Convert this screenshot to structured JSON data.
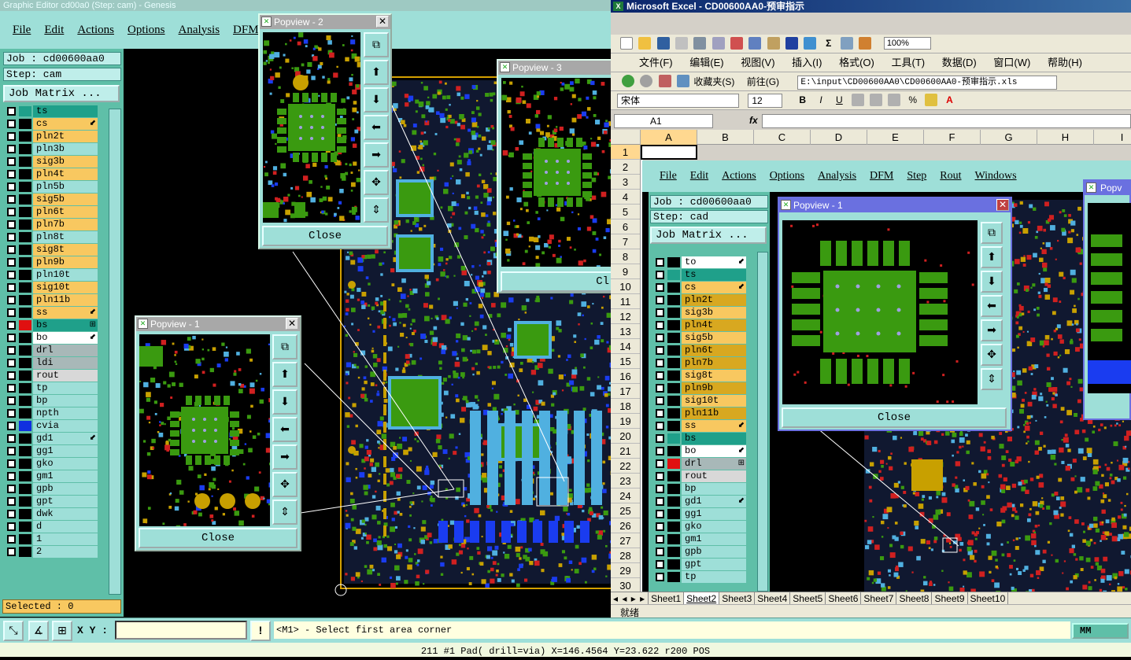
{
  "genesis": {
    "title": "Graphic Editor cd00a0 (Step: cam) - Genesis",
    "menu": [
      "File",
      "Edit",
      "Actions",
      "Options",
      "Analysis",
      "DFM"
    ],
    "job": "Job : cd00600aa0",
    "step": "Step: cam",
    "job_matrix": "Job Matrix ...",
    "layers": [
      {
        "name": "ts",
        "bg": "#1fa08a",
        "color": "#1fa08a",
        "mark": ""
      },
      {
        "name": "cs",
        "bg": "#f8c860",
        "color": "#000",
        "mark": "⬋"
      },
      {
        "name": "pln2t",
        "bg": "#f8c860",
        "color": "#000",
        "mark": ""
      },
      {
        "name": "pln3b",
        "bg": "#9edfd8",
        "color": "#000",
        "mark": ""
      },
      {
        "name": "sig3b",
        "bg": "#f8c860",
        "color": "#000",
        "mark": ""
      },
      {
        "name": "pln4t",
        "bg": "#f8c860",
        "color": "#000",
        "mark": ""
      },
      {
        "name": "pln5b",
        "bg": "#9edfd8",
        "color": "#000",
        "mark": ""
      },
      {
        "name": "sig5b",
        "bg": "#f8c860",
        "color": "#000",
        "mark": ""
      },
      {
        "name": "pln6t",
        "bg": "#f8c860",
        "color": "#000",
        "mark": ""
      },
      {
        "name": "pln7b",
        "bg": "#f8c860",
        "color": "#000",
        "mark": ""
      },
      {
        "name": "pln8t",
        "bg": "#9edfd8",
        "color": "#000",
        "mark": ""
      },
      {
        "name": "sig8t",
        "bg": "#f8c860",
        "color": "#000",
        "mark": ""
      },
      {
        "name": "pln9b",
        "bg": "#f8c860",
        "color": "#000",
        "mark": ""
      },
      {
        "name": "pln10t",
        "bg": "#9edfd8",
        "color": "#000",
        "mark": ""
      },
      {
        "name": "sig10t",
        "bg": "#f8c860",
        "color": "#000",
        "mark": ""
      },
      {
        "name": "pln11b",
        "bg": "#f8c860",
        "color": "#000",
        "mark": ""
      },
      {
        "name": "ss",
        "bg": "#f8c860",
        "color": "#000",
        "mark": "⬋"
      },
      {
        "name": "bs",
        "bg": "#1fa08a",
        "color": "#e01010",
        "mark": "⊞"
      },
      {
        "name": "bo",
        "bg": "#ffffff",
        "color": "#000",
        "mark": "⬋"
      },
      {
        "name": "drl",
        "bg": "#a8b8b8",
        "color": "#000",
        "mark": ""
      },
      {
        "name": "ldi",
        "bg": "#a8b8b8",
        "color": "#000",
        "mark": ""
      },
      {
        "name": "rout",
        "bg": "#d8d8d8",
        "color": "#000",
        "mark": ""
      },
      {
        "name": "tp",
        "bg": "#9edfd8",
        "color": "#000",
        "mark": ""
      },
      {
        "name": "bp",
        "bg": "#9edfd8",
        "color": "#000",
        "mark": ""
      },
      {
        "name": "npth",
        "bg": "#9edfd8",
        "color": "#000",
        "mark": ""
      },
      {
        "name": "cvia",
        "bg": "#9edfd8",
        "color": "#1030e0",
        "mark": ""
      },
      {
        "name": "gd1",
        "bg": "#9edfd8",
        "color": "#000",
        "mark": "⬋"
      },
      {
        "name": "gg1",
        "bg": "#9edfd8",
        "color": "#000",
        "mark": ""
      },
      {
        "name": "gko",
        "bg": "#9edfd8",
        "color": "#000",
        "mark": ""
      },
      {
        "name": "gm1",
        "bg": "#9edfd8",
        "color": "#000",
        "mark": ""
      },
      {
        "name": "gpb",
        "bg": "#9edfd8",
        "color": "#000",
        "mark": ""
      },
      {
        "name": "gpt",
        "bg": "#9edfd8",
        "color": "#000",
        "mark": ""
      },
      {
        "name": "dwk",
        "bg": "#9edfd8",
        "color": "#000",
        "mark": ""
      },
      {
        "name": "d",
        "bg": "#9edfd8",
        "color": "#000",
        "mark": ""
      },
      {
        "name": "1",
        "bg": "#9edfd8",
        "color": "#000",
        "mark": ""
      },
      {
        "name": "2",
        "bg": "#9edfd8",
        "color": "#000",
        "mark": ""
      }
    ],
    "selected": "Selected : 0",
    "xy_label": "X Y :",
    "prompt": "<M1> - Select first area corner",
    "units": "MM",
    "status": "211 #1 Pad( drill=via) X=146.4564 Y=23.622 r200 POS"
  },
  "popviews": {
    "p1_title": "Popview - 1",
    "p2_title": "Popview - 2",
    "p3_title": "Popview - 3",
    "close": "Close",
    "close_short": "Cl"
  },
  "excel": {
    "title": "Microsoft Excel - CD00600AA0-预审指示",
    "menu": [
      "文件(F)",
      "编辑(E)",
      "视图(V)",
      "插入(I)",
      "格式(O)",
      "工具(T)",
      "数据(D)",
      "窗口(W)",
      "帮助(H)"
    ],
    "zoom": "100%",
    "favorites": "收藏夹(S)",
    "goto": "前往(G)",
    "path": "E:\\input\\CD00600AA0\\CD00600AA0-预审指示.xls",
    "font": "宋体",
    "font_size": "12",
    "name_box": "A1",
    "fx": "fx",
    "columns": [
      "A",
      "B",
      "C",
      "D",
      "E",
      "F",
      "G",
      "H",
      "I"
    ],
    "rows": [
      "1",
      "2",
      "3",
      "4",
      "5",
      "6",
      "7",
      "8",
      "9",
      "10",
      "11",
      "12",
      "13",
      "14",
      "15",
      "16",
      "17",
      "18",
      "19",
      "20",
      "21",
      "22",
      "23",
      "24",
      "25",
      "26",
      "27",
      "28",
      "29",
      "30"
    ],
    "sheets": [
      "Sheet1",
      "Sheet2",
      "Sheet3",
      "Sheet4",
      "Sheet5",
      "Sheet6",
      "Sheet7",
      "Sheet8",
      "Sheet9",
      "Sheet10"
    ],
    "status": "就绪"
  },
  "embedded": {
    "menu": [
      "File",
      "Edit",
      "Actions",
      "Options",
      "Analysis",
      "DFM",
      "Step",
      "Rout",
      "Windows"
    ],
    "job": "Job : cd00600aa0",
    "step": "Step: cad",
    "job_matrix": "Job Matrix ...",
    "layers": [
      {
        "name": "to",
        "bg": "#ffffff",
        "color": "#000",
        "mark": "⬋"
      },
      {
        "name": "ts",
        "bg": "#1fa08a",
        "color": "#1fa08a",
        "mark": ""
      },
      {
        "name": "cs",
        "bg": "#f8c860",
        "color": "#000",
        "mark": "⬋"
      },
      {
        "name": "pln2t",
        "bg": "#d8a820",
        "color": "#000",
        "mark": ""
      },
      {
        "name": "sig3b",
        "bg": "#f8c860",
        "color": "#000",
        "mark": ""
      },
      {
        "name": "pln4t",
        "bg": "#d8a820",
        "color": "#000",
        "mark": ""
      },
      {
        "name": "sig5b",
        "bg": "#f8c860",
        "color": "#000",
        "mark": ""
      },
      {
        "name": "pln6t",
        "bg": "#d8a820",
        "color": "#000",
        "mark": ""
      },
      {
        "name": "pln7b",
        "bg": "#d8a820",
        "color": "#000",
        "mark": ""
      },
      {
        "name": "sig8t",
        "bg": "#f8c860",
        "color": "#000",
        "mark": ""
      },
      {
        "name": "pln9b",
        "bg": "#d8a820",
        "color": "#000",
        "mark": ""
      },
      {
        "name": "sig10t",
        "bg": "#f8c860",
        "color": "#000",
        "mark": ""
      },
      {
        "name": "pln11b",
        "bg": "#d8a820",
        "color": "#000",
        "mark": ""
      },
      {
        "name": "ss",
        "bg": "#f8c860",
        "color": "#000",
        "mark": "⬋"
      },
      {
        "name": "bs",
        "bg": "#1fa08a",
        "color": "#1fa08a",
        "mark": ""
      },
      {
        "name": "bo",
        "bg": "#ffffff",
        "color": "#000",
        "mark": "⬋"
      },
      {
        "name": "drl",
        "bg": "#a8b8b8",
        "color": "#e01010",
        "mark": "⊞"
      },
      {
        "name": "rout",
        "bg": "#d8d8d8",
        "color": "#000",
        "mark": ""
      },
      {
        "name": "bp",
        "bg": "#9edfd8",
        "color": "#000",
        "mark": ""
      },
      {
        "name": "gd1",
        "bg": "#9edfd8",
        "color": "#000",
        "mark": "⬋"
      },
      {
        "name": "gg1",
        "bg": "#9edfd8",
        "color": "#000",
        "mark": ""
      },
      {
        "name": "gko",
        "bg": "#9edfd8",
        "color": "#000",
        "mark": ""
      },
      {
        "name": "gm1",
        "bg": "#9edfd8",
        "color": "#000",
        "mark": ""
      },
      {
        "name": "gpb",
        "bg": "#9edfd8",
        "color": "#000",
        "mark": ""
      },
      {
        "name": "gpt",
        "bg": "#9edfd8",
        "color": "#000",
        "mark": ""
      },
      {
        "name": "tp",
        "bg": "#9edfd8",
        "color": "#000",
        "mark": ""
      }
    ]
  }
}
